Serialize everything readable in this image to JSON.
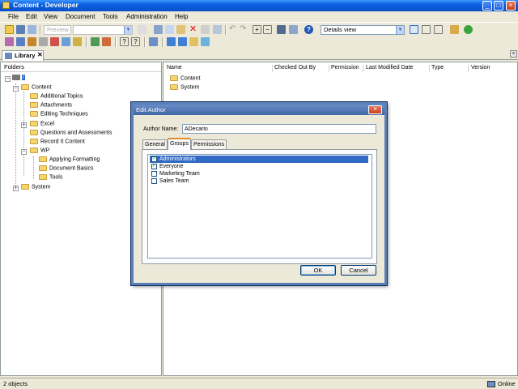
{
  "window": {
    "title": "Content - Developer"
  },
  "menu": [
    "File",
    "Edit",
    "View",
    "Document",
    "Tools",
    "Administration",
    "Help"
  ],
  "toolbar": {
    "preview_label": "Preview",
    "view_select": "Details view"
  },
  "tab": {
    "label": "Library"
  },
  "folders": {
    "header": "Folders",
    "root": "/",
    "content": "Content",
    "children": [
      "Additional Topics",
      "Attachments",
      "Editing Techniques",
      "Excel",
      "Questions and Assessments",
      "Record It Content",
      "WP"
    ],
    "wp_children": [
      "Applying Formatting",
      "Document Basics",
      "Tools"
    ],
    "system": "System"
  },
  "list": {
    "columns": [
      "Name",
      "Checked Out By",
      "Permission",
      "Last Modified Date",
      "Type",
      "Version"
    ],
    "rows": [
      "Content",
      "System"
    ]
  },
  "dialog": {
    "title": "Edit Author",
    "name_label": "Author Name:",
    "name_value": "ADecarlo",
    "tabs": [
      "General",
      "Groups",
      "Permissions"
    ],
    "active_tab": "Groups",
    "groups": [
      {
        "name": "Administrators",
        "checked": true,
        "selected": true
      },
      {
        "name": "Everyone",
        "checked": true,
        "selected": false
      },
      {
        "name": "Marketing Team",
        "checked": false,
        "selected": false
      },
      {
        "name": "Sales Team",
        "checked": false,
        "selected": false
      }
    ],
    "ok_label": "OK",
    "cancel_label": "Cancel"
  },
  "status": {
    "count": "2 objects",
    "connection": "Online"
  }
}
